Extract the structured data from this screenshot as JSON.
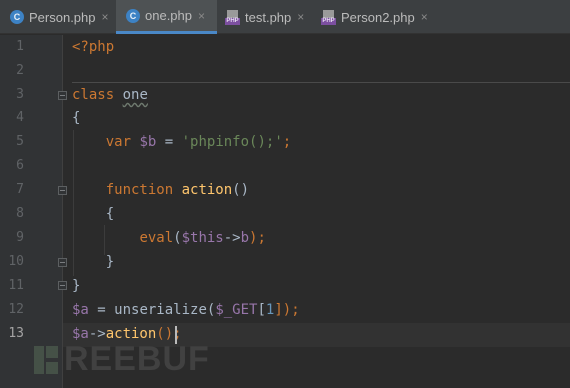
{
  "tabs": [
    {
      "label": "Person.php",
      "icon": "class-c-icon",
      "close": "×",
      "active": false
    },
    {
      "label": "one.php",
      "icon": "class-c-icon",
      "close": "×",
      "active": true
    },
    {
      "label": "test.php",
      "icon": "php-file-icon",
      "close": "×",
      "active": false
    },
    {
      "label": "Person2.php",
      "icon": "php-file-icon",
      "close": "×",
      "active": false
    }
  ],
  "icon_text": {
    "c": "C",
    "php": "PHP"
  },
  "line_numbers": [
    "1",
    "2",
    "3",
    "4",
    "5",
    "6",
    "7",
    "8",
    "9",
    "10",
    "11",
    "12",
    "13"
  ],
  "current_line": "13",
  "code": {
    "l1_open": "<?php",
    "l3_kw": "class",
    "l3_name": "one",
    "l4": "{",
    "l5_kw": "var",
    "l5_var": "$b",
    "l5_eq": " = ",
    "l5_str": "'phpinfo();'",
    "l5_semi": ";",
    "l7_kw": "function",
    "l7_fn": "action",
    "l7_paren": "()",
    "l8": "{",
    "l9_fn": "eval",
    "l9_open": "(",
    "l9_this": "$this",
    "l9_arrow": "->",
    "l9_prop": "b",
    "l9_close": ");",
    "l10": "}",
    "l11": "}",
    "l12_var": "$a",
    "l12_eq": " = ",
    "l12_fn": "unserialize",
    "l12_open": "(",
    "l12_get": "$_GET",
    "l12_lb": "[",
    "l12_num": "1",
    "l12_rb": "]);",
    "l13_var": "$a",
    "l13_arrow": "->",
    "l13_fn": "action",
    "l13_rest": "();"
  },
  "watermark": "REEBUF",
  "colors": {
    "keyword": "#cc7832",
    "variable": "#9876aa",
    "string": "#6a8759",
    "function": "#ffc66d",
    "number": "#6897bb",
    "text": "#a9b7c6",
    "background": "#2b2b2b",
    "tab_active_underline": "#4a88c7"
  }
}
